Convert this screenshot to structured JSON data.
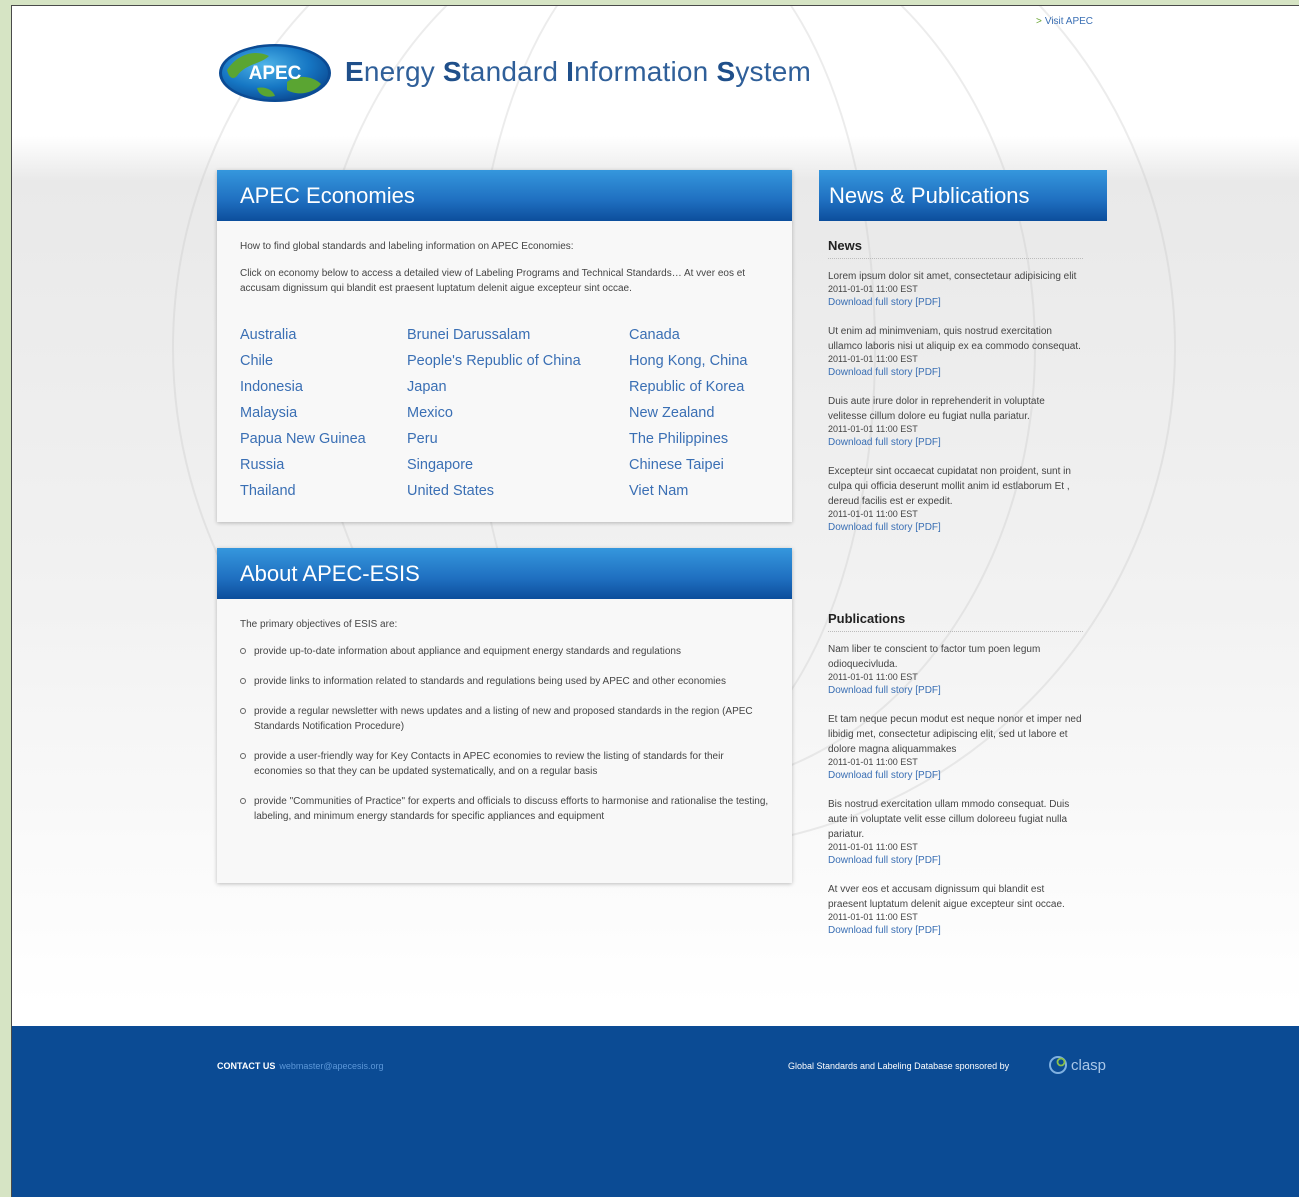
{
  "header": {
    "visit_link": "Visit APEC",
    "logo_text": "APEC",
    "title_parts": [
      {
        "cap": "E",
        "rest": "nergy "
      },
      {
        "cap": "S",
        "rest": "tandard "
      },
      {
        "cap": "I",
        "rest": "nformation "
      },
      {
        "cap": "S",
        "rest": "ystem"
      }
    ]
  },
  "economies": {
    "title": "APEC Economies",
    "intro": "How to find global standards and labeling information on APEC Economies:",
    "instructions": "Click on economy below to access a detailed view of Labeling Programs and Technical Standards… At vver eos et accusam dignissum qui blandit est praesent luptatum delenit aigue excepteur sint occae.",
    "columns": [
      [
        "Australia",
        "Chile",
        "Indonesia",
        "Malaysia",
        "Papua New Guinea",
        "Russia",
        "Thailand"
      ],
      [
        "Brunei Darussalam",
        "People's Republic of China",
        "Japan",
        "Mexico",
        "Peru",
        "Singapore",
        "United States"
      ],
      [
        "Canada",
        "Hong Kong, China",
        "Republic of Korea",
        "New Zealand",
        "The Philippines",
        "Chinese Taipei",
        "Viet Nam"
      ]
    ]
  },
  "about": {
    "title": "About APEC-ESIS",
    "intro": "The primary objectives of ESIS are:",
    "objectives": [
      "provide up-to-date information about appliance and equipment energy standards and regulations",
      "provide links to information related to standards and regulations being used by APEC and other economies",
      "provide a regular newsletter with news updates and a listing of new and proposed standards in the region (APEC Standards Notification Procedure)",
      "provide a user-friendly way for Key Contacts in APEC economies to review the listing of standards for their economies so that they can be updated systematically, and on a regular basis",
      "provide \"Communities of Practice\" for experts and officials to discuss efforts to harmonise and rationalise the testing, labeling, and minimum energy standards for specific appliances and equipment"
    ]
  },
  "news_panel": {
    "title": "News & Publications",
    "news_heading": "News",
    "news": [
      {
        "text": "Lorem ipsum dolor sit amet, consectetaur adipisicing elit",
        "date": "2011-01-01 11:00 EST",
        "link": "Download full story [PDF]"
      },
      {
        "text": "Ut enim ad minimveniam, quis nostrud exercitation ullamco laboris nisi ut aliquip ex ea commodo consequat.",
        "date": "2011-01-01 11:00 EST",
        "link": "Download full story [PDF]"
      },
      {
        "text": "Duis aute irure dolor in reprehenderit in voluptate velitesse cillum dolore eu fugiat nulla pariatur.",
        "date": "2011-01-01 11:00 EST",
        "link": "Download full story [PDF]"
      },
      {
        "text": "Excepteur sint occaecat cupidatat non proident, sunt in culpa qui officia deserunt mollit anim id estlaborum Et , dereud facilis est er expedit.",
        "date": "2011-01-01 11:00 EST",
        "link": "Download full story [PDF]"
      }
    ],
    "publications_heading": "Publications",
    "publications": [
      {
        "text": "Nam liber te conscient to factor tum poen legum odioquecivluda.",
        "date": "2011-01-01 11:00 EST",
        "link": "Download full story [PDF]"
      },
      {
        "text": "Et tam neque pecun modut est neque nonor et imper ned libidig met, consectetur adipiscing elit, sed ut labore et dolore magna aliquammakes",
        "date": "2011-01-01 11:00 EST",
        "link": "Download full story [PDF]"
      },
      {
        "text": "Bis nostrud exercitation ullam mmodo consequat. Duis aute in voluptate velit esse cillum doloreeu fugiat nulla pariatur.",
        "date": "2011-01-01 11:00 EST",
        "link": "Download full story [PDF]"
      },
      {
        "text": "At vver eos et accusam dignissum qui blandit est praesent luptatum delenit aigue excepteur sint occae.",
        "date": "2011-01-01 11:00 EST",
        "link": "Download full story [PDF]"
      }
    ]
  },
  "footer": {
    "contact_label": "CONTACT US",
    "contact_email": "webmaster@apecesis.org",
    "sponsor_text": "Global Standards and Labeling Database sponsored by",
    "sponsor_logo_text": "clasp"
  },
  "colors": {
    "brand_blue": "#0b4b94",
    "link_blue": "#3a6fb4",
    "header_gradient_top": "#3597dd",
    "header_gradient_bottom": "#0c4e9c",
    "accent_green": "#6aa532"
  }
}
